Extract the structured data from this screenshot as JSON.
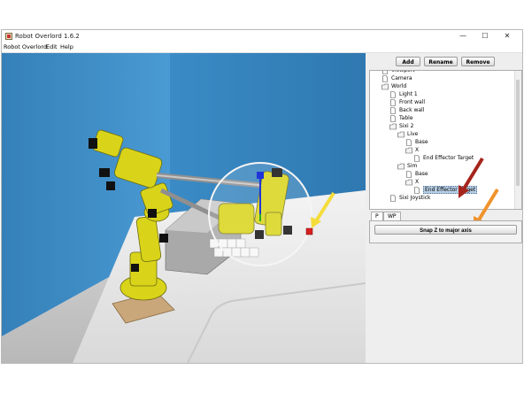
{
  "window": {
    "title": "Robot Overlord 1.6.2",
    "controls": [
      "—",
      "☐",
      "✕"
    ]
  },
  "menu": [
    "Robot Overlord",
    "Edit",
    "Help"
  ],
  "toolbar": {
    "add": "Add",
    "rename": "Rename",
    "remove": "Remove"
  },
  "tree": {
    "items": [
      {
        "label": "Viewport",
        "type": "file"
      },
      {
        "label": "Camera",
        "type": "file"
      },
      {
        "label": "World",
        "type": "folder"
      },
      {
        "label": "Light 1",
        "type": "file"
      },
      {
        "label": "Front wall",
        "type": "file"
      },
      {
        "label": "Back wall",
        "type": "file"
      },
      {
        "label": "Table",
        "type": "file"
      },
      {
        "label": "Sixi 2",
        "type": "folder"
      },
      {
        "label": "Live",
        "type": "folder"
      },
      {
        "label": "Base",
        "type": "file"
      },
      {
        "label": "X",
        "type": "folder"
      },
      {
        "label": "End Effector Target",
        "type": "file"
      },
      {
        "label": "Sim",
        "type": "folder"
      },
      {
        "label": "Base",
        "type": "file"
      },
      {
        "label": "X",
        "type": "folder"
      },
      {
        "label": "End Effector Target",
        "type": "file",
        "selected": true
      },
      {
        "label": "Sixi Joystick",
        "type": "file"
      }
    ]
  },
  "tabs": [
    "P",
    "WP"
  ],
  "snap_button": "Snap Z to major axis",
  "colors": {
    "wall": "#3f8ec7",
    "robot": "#d9d41a",
    "selection_highlight": "#b8cfe5",
    "arrow_yellow": "#f5dc3a",
    "arrow_darkred": "#a5241b",
    "arrow_orange": "#f0932b"
  }
}
